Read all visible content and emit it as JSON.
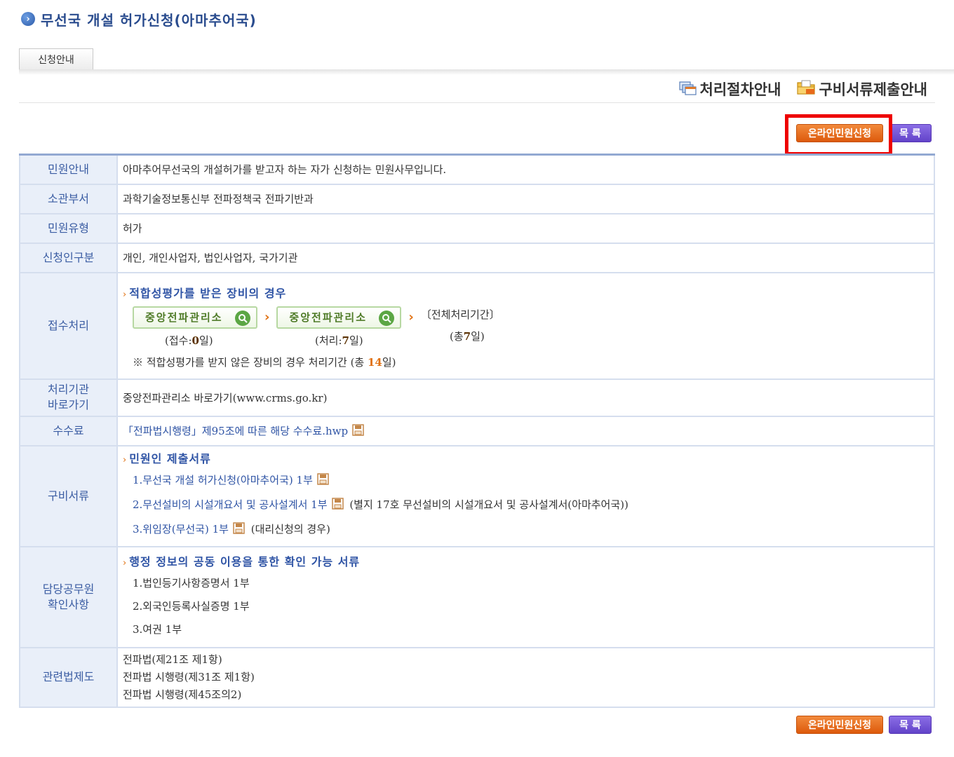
{
  "header": {
    "title": "무선국 개설 허가신청(아마추어국)",
    "title_icon": "chevron-circle-icon"
  },
  "tabs": [
    {
      "label": "신청안내"
    }
  ],
  "guide_links": [
    {
      "label": "처리절차안내",
      "icon": "process-guide-icon"
    },
    {
      "label": "구비서류제출안내",
      "icon": "document-submit-icon"
    }
  ],
  "actions": {
    "apply_label": "온라인민원신청",
    "list_label": "목 록"
  },
  "colors": {
    "accent_orange": "#dd5a0c",
    "accent_purple": "#6243c9",
    "header_blue": "#2a4c8e",
    "highlight": "#ee0000"
  },
  "table": {
    "guide": {
      "label": "민원안내",
      "value": "아마추어무선국의 개설허가를 받고자 하는 자가 신청하는 민원사무입니다."
    },
    "dept": {
      "label": "소관부서",
      "value": "과학기술정보통신부 전파정책국 전파기반과"
    },
    "type": {
      "label": "민원유형",
      "value": "허가"
    },
    "applicant": {
      "label": "신청인구분",
      "value": "개인, 개인사업자, 법인사업자, 국가기관"
    },
    "process": {
      "label": "접수처리",
      "section_title": "적합성평가를 받은 장비의 경우",
      "step1": {
        "name": "중앙전파관리소",
        "caption_pre": "(접수: ",
        "days": "0",
        "caption_post": " 일)"
      },
      "step2": {
        "name": "중앙전파관리소",
        "caption_pre": "(처리: ",
        "days": "7",
        "caption_post": " 일)"
      },
      "total": {
        "label": "〔전체처리기간〕",
        "caption_pre": "(총 ",
        "days": "7",
        "caption_post": " 일)"
      },
      "note_pre": "※ 적합성평가를 받지 않은 장비의 경우 처리기간 (총 ",
      "note_days": "14",
      "note_post": "일)"
    },
    "agency": {
      "label_line1": "처리기관",
      "label_line2": "바로가기",
      "value": "중앙전파관리소 바로가기(www.crms.go.kr)"
    },
    "fee": {
      "label": "수수료",
      "value": "「전파법시행령」제95조에 따른 해당 수수료.hwp"
    },
    "docs": {
      "label": "구비서류",
      "section_title": "민원인 제출서류",
      "items": [
        {
          "text": "1.무선국 개설 허가신청(아마추어국) 1부",
          "extra": ""
        },
        {
          "text": "2.무선설비의 시설개요서 및 공사설계서 1부",
          "extra": "(별지 17호 무선설비의 시설개요서 및 공사설계서(아마추어국))"
        },
        {
          "text": "3.위임장(무선국) 1부",
          "extra": "(대리신청의 경우)"
        }
      ]
    },
    "official": {
      "label_line1": "담당공무원",
      "label_line2": "확인사항",
      "section_title": "행정 정보의 공동 이용을 통한 확인 가능 서류",
      "items": [
        "1.법인등기사항증명서 1부",
        "2.외국인등록사실증명 1부",
        "3.여권 1부"
      ]
    },
    "law": {
      "label": "관련법제도",
      "items": [
        "전파법(제21조 제1항)",
        "전파법 시행령(제31조 제1항)",
        "전파법 시행령(제45조의2)"
      ]
    }
  }
}
